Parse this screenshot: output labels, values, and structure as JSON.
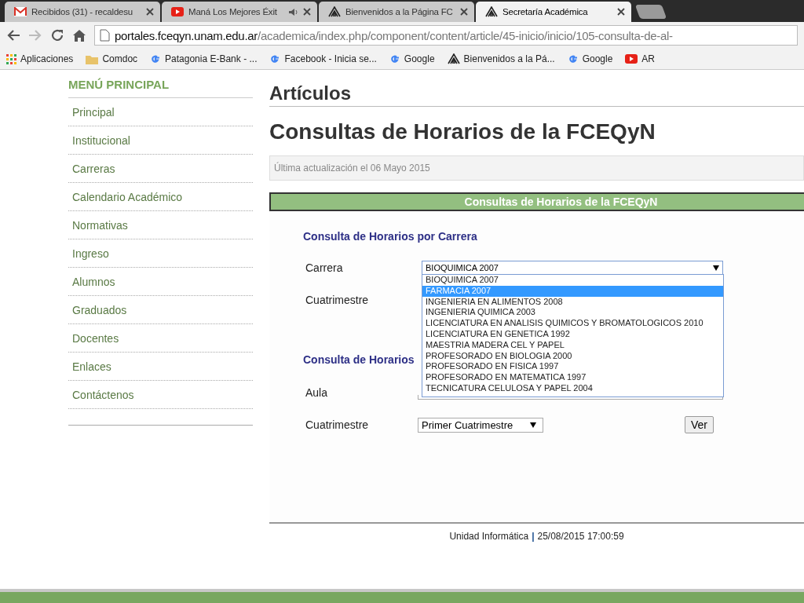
{
  "browser": {
    "tabs": [
      {
        "kind": "gmail",
        "title": "Recibidos (31) - recaldesu",
        "selected": false,
        "audio": false
      },
      {
        "kind": "youtube",
        "title": "Maná Los Mejores Éxit",
        "selected": false,
        "audio": true
      },
      {
        "kind": "fceqyn",
        "title": "Bienvenidos a la Página FC",
        "selected": false,
        "audio": false
      },
      {
        "kind": "fceqyn",
        "title": "Secretaría Académica",
        "selected": true,
        "audio": false
      }
    ],
    "address": {
      "host": "portales.fceqyn.unam.edu.ar",
      "path": "/academica/index.php/component/content/article/45-inicio/inicio/105-consulta-de-al-"
    },
    "bookmarks": [
      {
        "kind": "apps",
        "label": "Aplicaciones"
      },
      {
        "kind": "folder",
        "label": "Comdoc"
      },
      {
        "kind": "google",
        "label": "Patagonia E-Bank - ..."
      },
      {
        "kind": "google",
        "label": "Facebook - Inicia se..."
      },
      {
        "kind": "google",
        "label": "Google"
      },
      {
        "kind": "fceqyn",
        "label": "Bienvenidos a la Pá..."
      },
      {
        "kind": "google",
        "label": "Google"
      },
      {
        "kind": "youtube",
        "label": "AR"
      }
    ]
  },
  "sidebar": {
    "title": "MENÚ PRINCIPAL",
    "items": [
      "Principal",
      "Institucional",
      "Carreras",
      "Calendario Académico",
      "Normativas",
      "Ingreso",
      "Alumnos",
      "Graduados",
      "Docentes",
      "Enlaces",
      "Contáctenos"
    ]
  },
  "main": {
    "section": "Artículos",
    "title": "Consultas de Horarios de la FCEQyN",
    "updated": "Última actualización el 06 Mayo 2015",
    "panel_title": "Consultas de Horarios de la FCEQyN",
    "form1": {
      "heading": "Consulta de Horarios por Carrera",
      "carrera_label": "Carrera",
      "carrera_value": "BIOQUIMICA 2007",
      "cuatrimestre_label": "Cuatrimestre",
      "options": [
        {
          "label": "BIOQUIMICA 2007",
          "selected": false
        },
        {
          "label": "FARMACIA 2007",
          "selected": true
        },
        {
          "label": "INGENIERIA EN ALIMENTOS 2008",
          "selected": false
        },
        {
          "label": "INGENIERIA QUIMICA 2003",
          "selected": false
        },
        {
          "label": "LICENCIATURA EN ANALISIS QUIMICOS Y BROMATOLOGICOS 2010",
          "selected": false
        },
        {
          "label": "LICENCIATURA EN GENETICA 1992",
          "selected": false
        },
        {
          "label": "MAESTRIA MADERA CEL Y PAPEL",
          "selected": false
        },
        {
          "label": "PROFESORADO EN BIOLOGIA 2000",
          "selected": false
        },
        {
          "label": "PROFESORADO EN FISICA 1997",
          "selected": false
        },
        {
          "label": "PROFESORADO EN MATEMATICA 1997",
          "selected": false
        },
        {
          "label": "TECNICATURA CELULOSA Y PAPEL 2004",
          "selected": false
        }
      ]
    },
    "form2": {
      "heading": "Consulta de Horarios",
      "aula_label": "Aula",
      "cuatrimestre_label": "Cuatrimestre",
      "cuatrimestre_value": "Primer Cuatrimestre",
      "button": "Ver"
    },
    "footer": {
      "unit": "Unidad Informática",
      "separator": "|",
      "timestamp": "25/08/2015 17:00:59"
    }
  }
}
